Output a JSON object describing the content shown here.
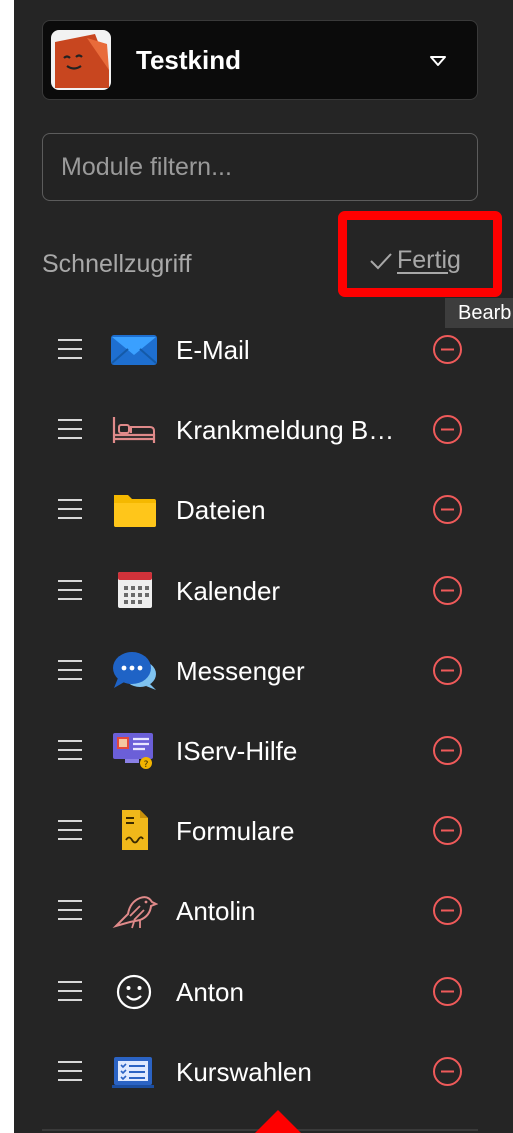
{
  "profile": {
    "name": "Testkind",
    "avatar_icon": "smiling-face-avatar",
    "dropdown_icon": "chevron-down-icon"
  },
  "filter": {
    "placeholder": "Module filtern...",
    "value": ""
  },
  "quick_access": {
    "title": "Schnellzugriff",
    "done_label": "Fertig",
    "done_icon": "checkmark-icon",
    "tooltip": "Bearb"
  },
  "items": [
    {
      "label": "E-Mail",
      "icon": "mail-icon"
    },
    {
      "label": "Krankmeldung B…",
      "icon": "bed-icon"
    },
    {
      "label": "Dateien",
      "icon": "folder-icon"
    },
    {
      "label": "Kalender",
      "icon": "calendar-icon"
    },
    {
      "label": "Messenger",
      "icon": "chat-bubbles-icon"
    },
    {
      "label": "IServ-Hilfe",
      "icon": "help-screen-icon"
    },
    {
      "label": "Formulare",
      "icon": "form-document-icon"
    },
    {
      "label": "Antolin",
      "icon": "bird-icon"
    },
    {
      "label": "Anton",
      "icon": "smiley-icon"
    },
    {
      "label": "Kurswahlen",
      "icon": "course-list-icon"
    }
  ],
  "colors": {
    "sidebar_bg": "#252525",
    "remove_accent": "#ef5a5a",
    "highlight_red": "#ff0000",
    "text_primary": "#ffffff",
    "text_muted": "#a8a8a8"
  }
}
